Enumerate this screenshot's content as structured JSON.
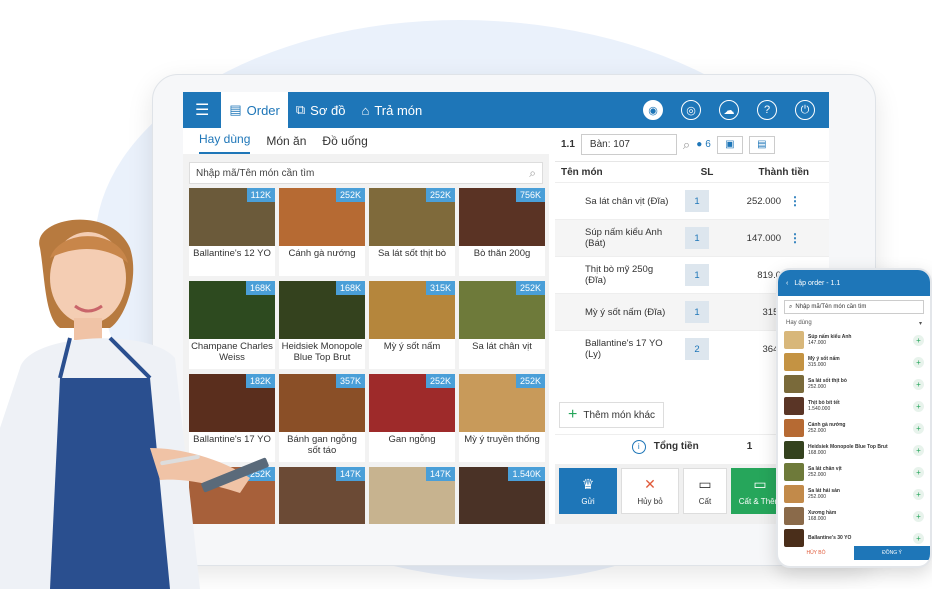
{
  "topbar": {
    "menu_icon": "menu-icon",
    "order": "Order",
    "map": "Sơ đồ",
    "return": "Trả món"
  },
  "left": {
    "tabs": [
      "Hay dùng",
      "Món ăn",
      "Đồ uống"
    ],
    "search_placeholder": "Nhập mã/Tên món cần tìm",
    "items": [
      {
        "name": "Ballantine's 12 YO",
        "price": "112K",
        "color": "#6b5a3a"
      },
      {
        "name": "Cánh gà nướng",
        "price": "252K",
        "color": "#b66a33"
      },
      {
        "name": "Sa lát sốt thịt bò",
        "price": "252K",
        "color": "#7f6a3b"
      },
      {
        "name": "Bò thăn 200g",
        "price": "756K",
        "color": "#5a3324"
      },
      {
        "name": "Champane Charles Weiss",
        "price": "168K",
        "color": "#2d4a1f"
      },
      {
        "name": "Heidsiek Monopole Blue Top Brut",
        "price": "168K",
        "color": "#34421e"
      },
      {
        "name": "Mỳ ý sốt nấm",
        "price": "315K",
        "color": "#b5863c"
      },
      {
        "name": "Sa lát chân vịt",
        "price": "252K",
        "color": "#6e7a3a"
      },
      {
        "name": "Ballantine's 17 YO",
        "price": "182K",
        "color": "#5a2e1d"
      },
      {
        "name": "Bánh gan ngỗng sốt táo",
        "price": "357K",
        "color": "#8a4f27"
      },
      {
        "name": "Gan ngỗng",
        "price": "252K",
        "color": "#9e2a2a"
      },
      {
        "name": "Mỳ ý truyền thống",
        "price": "252K",
        "color": "#c89a5a"
      },
      {
        "name": "",
        "price": "252K",
        "color": "#a7603a"
      },
      {
        "name": "",
        "price": "147K",
        "color": "#6b4a35"
      },
      {
        "name": "",
        "price": "147K",
        "color": "#c7b38f"
      },
      {
        "name": "",
        "price": "1.540K",
        "color": "#4a3226"
      }
    ]
  },
  "right": {
    "table_no": "1.1",
    "table": "Bàn: 107",
    "guests": "6",
    "col_name": "Tên món",
    "col_qty": "SL",
    "col_total": "Thành tiền",
    "rows": [
      {
        "name": "Sa lát chân vịt (Đĩa)",
        "qty": "1",
        "total": "252.000"
      },
      {
        "name": "Súp nấm kiểu Anh (Bát)",
        "qty": "1",
        "total": "147.000"
      },
      {
        "name": "Thịt bò mỹ 250g (Đĩa)",
        "qty": "1",
        "total": "819.0"
      },
      {
        "name": "Mỳ ý sốt nấm (Đĩa)",
        "qty": "1",
        "total": "315."
      },
      {
        "name": "Ballantine's 17 YO (Ly)",
        "qty": "2",
        "total": "364."
      }
    ],
    "add_more": "Thêm món khác",
    "total_label": "Tổng tiền",
    "total_value": "1",
    "buttons": [
      "Gửi",
      "Hủy bỏ",
      "Cất",
      "Cất & Thêm"
    ]
  },
  "phone": {
    "title": "Lập order - 1.1",
    "search": "Nhập mã/Tên món cần tìm",
    "filter": "Hay dùng",
    "items": [
      {
        "name": "Súp nấm kiểu Anh",
        "price": "147.000",
        "color": "#d8b77a"
      },
      {
        "name": "Mỳ ý sốt nấm",
        "price": "315.000",
        "color": "#c49343"
      },
      {
        "name": "Sa lát sốt thịt bò",
        "price": "252.000",
        "color": "#7a6a3a"
      },
      {
        "name": "Thịt bò bít tết",
        "price": "1.540.000",
        "color": "#5a3526"
      },
      {
        "name": "Cánh gà nướng",
        "price": "252.000",
        "color": "#b66a33"
      },
      {
        "name": "Heidsiek Monopole Blue Top Brut",
        "price": "168.000",
        "color": "#34421e"
      },
      {
        "name": "Sa lát chân vịt",
        "price": "252.000",
        "color": "#6e7a3a"
      },
      {
        "name": "Sa lát hải sản",
        "price": "252.000",
        "color": "#c28a4a"
      },
      {
        "name": "Xương hầm",
        "price": "168.000",
        "color": "#8a6a4a"
      },
      {
        "name": "Ballantine's 30 YO",
        "price": "",
        "color": "#4a2e1a"
      }
    ],
    "cancel": "HỦY BỎ",
    "ok": "ĐỒNG Ý"
  }
}
